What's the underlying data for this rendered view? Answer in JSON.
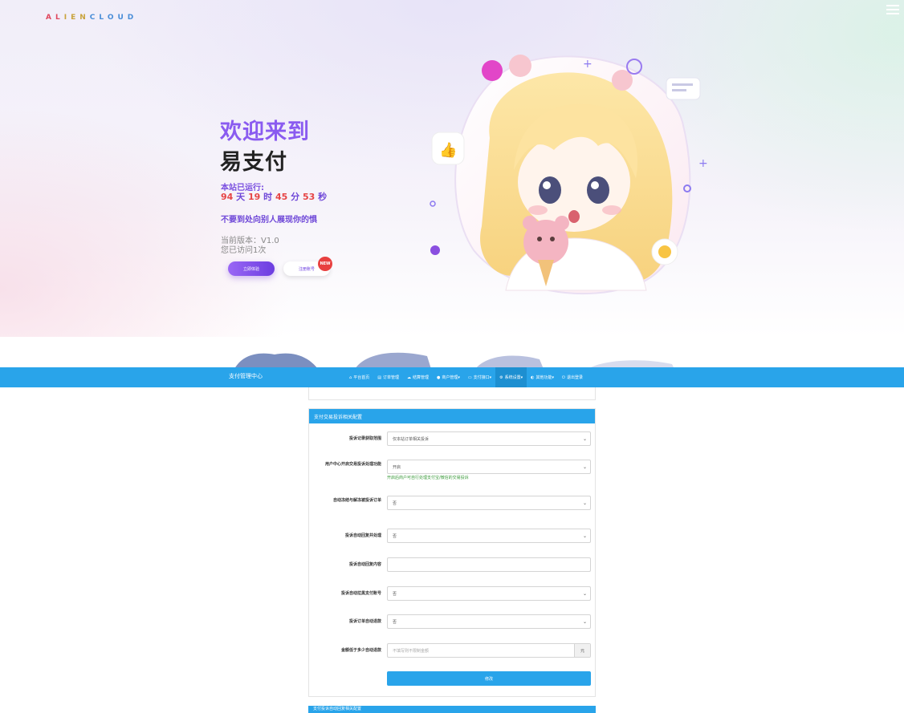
{
  "hero": {
    "brand": [
      "A",
      "L",
      "I",
      "E",
      "N",
      "C",
      "L",
      "O",
      "U",
      "D"
    ],
    "welcome": "欢迎来到",
    "site_name": "易支付",
    "running_label": "本站已运行:",
    "runtime": {
      "days": "94",
      "days_unit": "天",
      "hours": "19",
      "hours_unit": "时",
      "minutes": "45",
      "minutes_unit": "分",
      "seconds": "53",
      "seconds_unit": "秒"
    },
    "motto": "不要到处向别人展现你的惧",
    "version": "当前版本：V1.0",
    "visits": "您已访问1次",
    "experience_button": "立即体验",
    "register_button": "注册账号",
    "new_badge": "NEW"
  },
  "navbar": {
    "brand": "支付管理中心",
    "items": [
      {
        "icon": "home-icon",
        "label": "平台首页"
      },
      {
        "icon": "list-icon",
        "label": "订单管理"
      },
      {
        "icon": "cloud-icon",
        "label": "结算管理"
      },
      {
        "icon": "user-icon",
        "label": "商户管理▾"
      },
      {
        "icon": "card-icon",
        "label": "支付接口▾"
      },
      {
        "icon": "gear-icon",
        "label": "系统设置▾"
      },
      {
        "icon": "globe-icon",
        "label": "其他功能▾"
      },
      {
        "icon": "power-icon",
        "label": "退出登录"
      }
    ]
  },
  "panel": {
    "title": "支付交易投诉相关配置",
    "fields": [
      {
        "label": "投诉记录获取范围",
        "value": "仅本站订单相关投诉",
        "type": "select"
      },
      {
        "label": "用户中心开启交易投诉处理功能",
        "value": "开启",
        "type": "select",
        "hint": "开启后商户可自行处理支付宝/微信的交易投诉"
      },
      {
        "label": "自动冻结与解冻被投诉订单",
        "value": "否",
        "type": "select"
      },
      {
        "label": "投诉自动回复并处理",
        "value": "否",
        "type": "select"
      },
      {
        "label": "投诉自动回复内容",
        "value": "",
        "type": "input"
      },
      {
        "label": "投诉自动拉黑支付账号",
        "value": "否",
        "type": "select"
      },
      {
        "label": "投诉订单自动退款",
        "value": "否",
        "type": "select"
      },
      {
        "label": "金额低于多少自动退款",
        "placeholder": "不填写则不限制金额",
        "addon": "元",
        "type": "input-addon"
      }
    ],
    "submit": "修改"
  },
  "next_panel_title": "支付投诉自动回复相关配置",
  "colors": {
    "accent": "#29a4ea",
    "purple": "#8a5bf0",
    "red": "#e64545"
  }
}
